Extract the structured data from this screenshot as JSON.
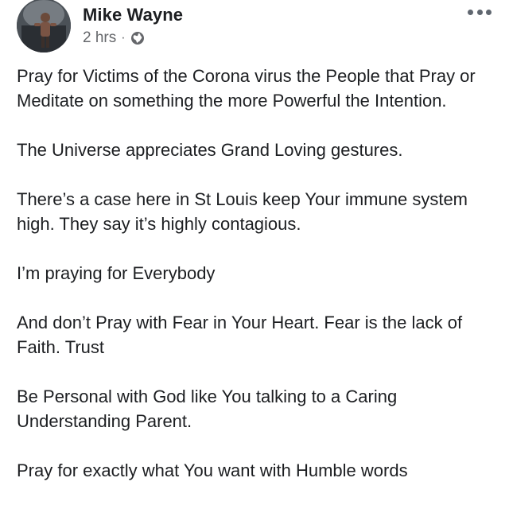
{
  "post": {
    "author": "Mike Wayne",
    "timestamp": "2 hrs",
    "separator": "·",
    "privacy_icon": "globe-icon",
    "more_icon": "more-options-icon",
    "paragraphs": [
      "Pray for Victims of the Corona virus the People that Pray or Meditate on something the more Powerful the Intention.",
      "The Universe appreciates Grand Loving gestures.",
      "There’s a case here in St Louis keep Your immune system high. They say it’s highly contagious.",
      "I’m praying for Everybody",
      "And don’t Pray with Fear in Your Heart. Fear is the lack of Faith. Trust",
      "Be Personal with God like You talking to a Caring Understanding Parent.",
      "Pray for exactly what You want with Humble words"
    ]
  },
  "colors": {
    "text": "#1c1e21",
    "meta": "#65676b",
    "icon": "#606770",
    "background": "#ffffff"
  }
}
